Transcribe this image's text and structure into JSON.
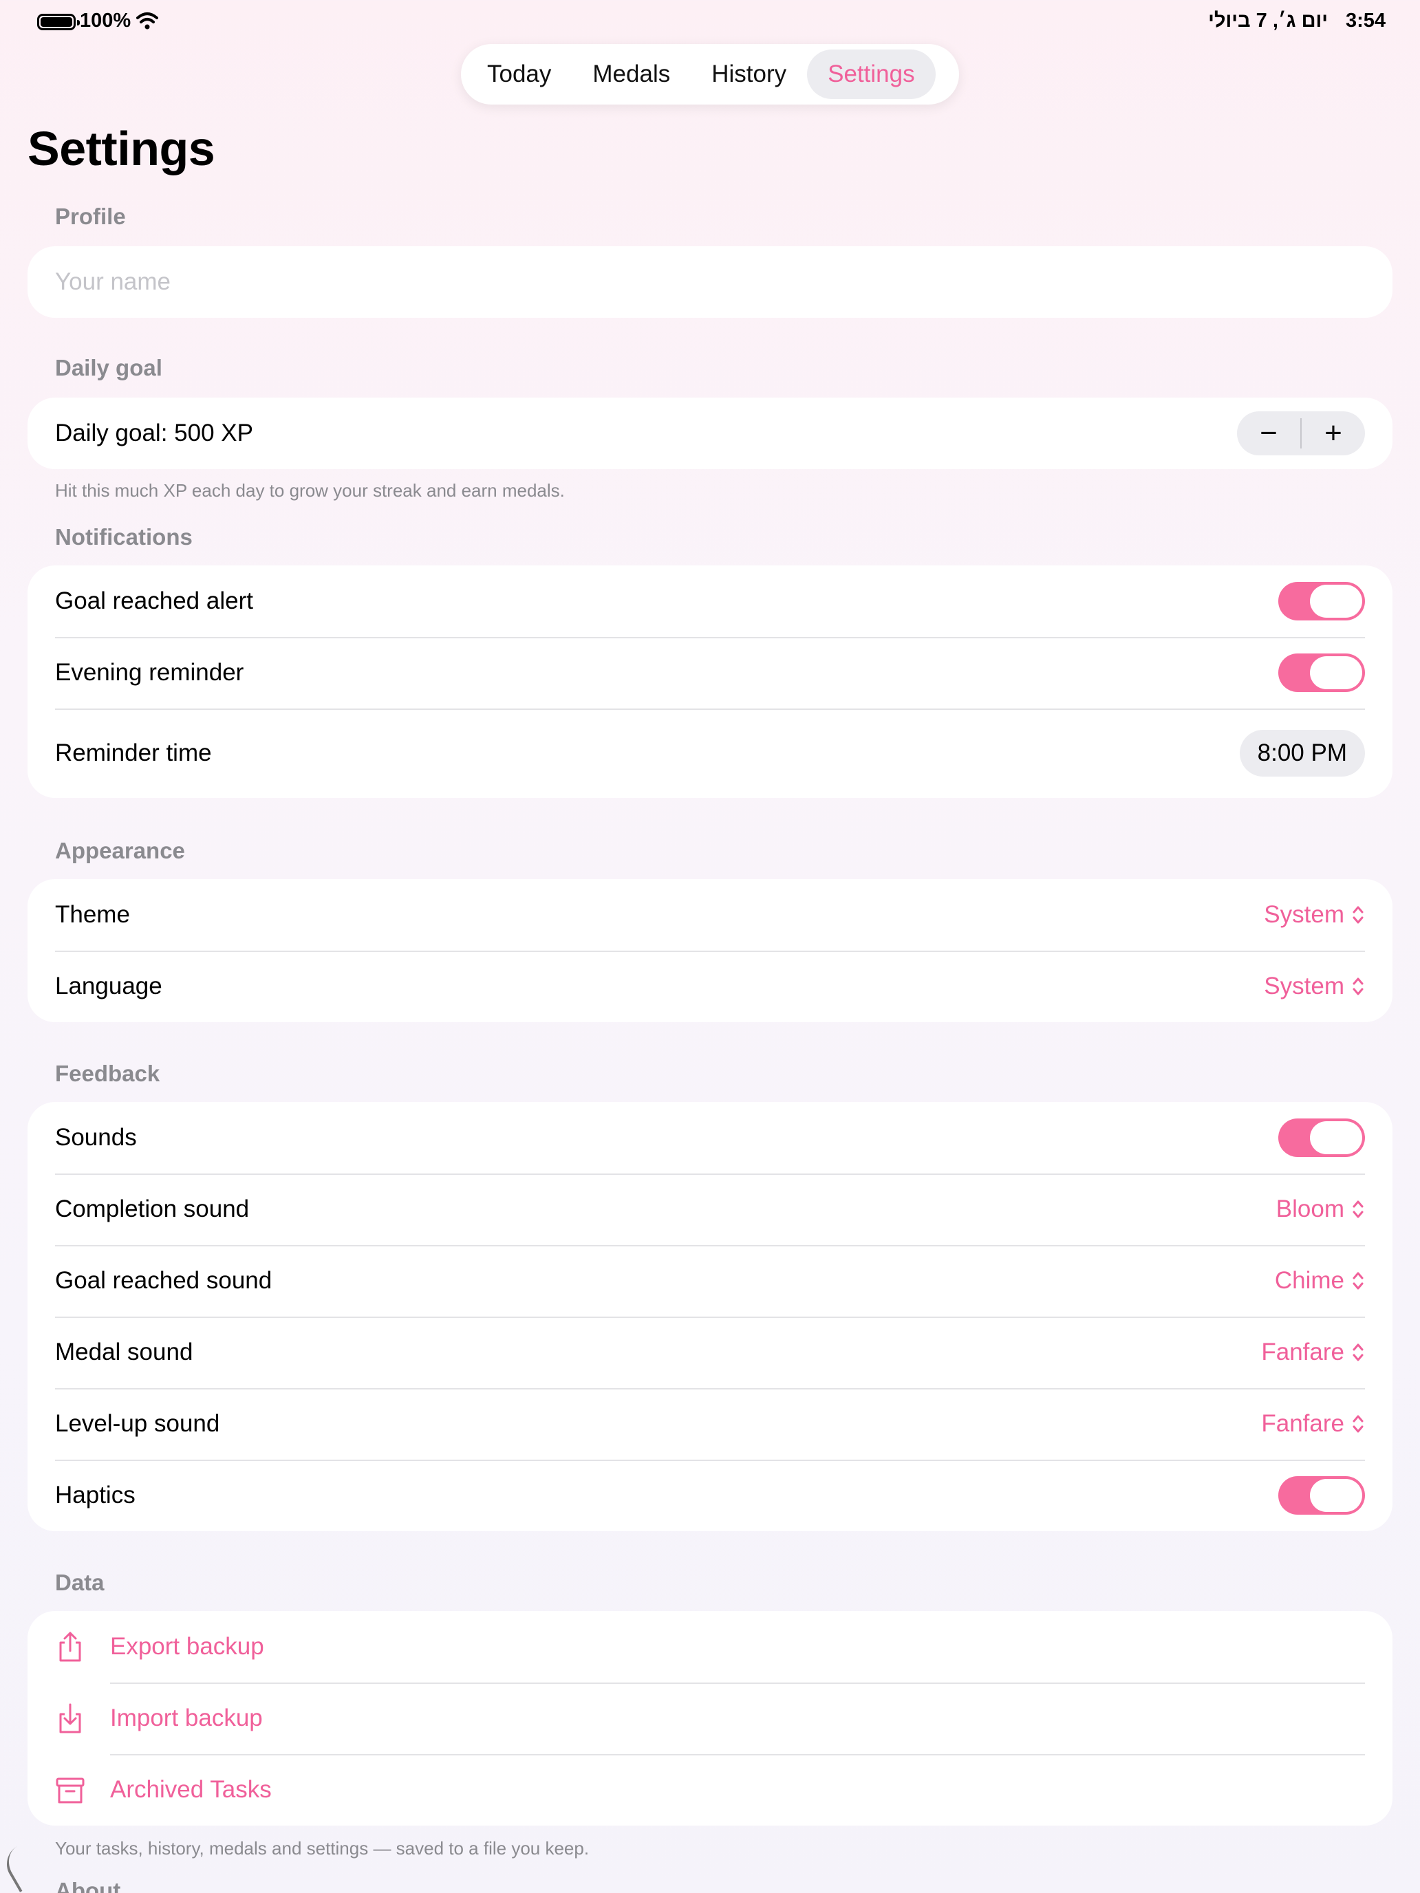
{
  "status_bar": {
    "battery": "100%",
    "date": "יום ג׳, 7 ביולי",
    "time": "3:54"
  },
  "tabs": [
    {
      "label": "Today",
      "active": false
    },
    {
      "label": "Medals",
      "active": false
    },
    {
      "label": "History",
      "active": false
    },
    {
      "label": "Settings",
      "active": true
    }
  ],
  "page_title": "Settings",
  "profile": {
    "header": "Profile",
    "name_placeholder": "Your name",
    "name_value": ""
  },
  "daily_goal": {
    "header": "Daily goal",
    "label": "Daily goal: 500 XP",
    "decrement": "−",
    "increment": "+",
    "footer": "Hit this much XP each day to grow your streak and earn medals."
  },
  "notifications": {
    "header": "Notifications",
    "goal_alert": {
      "label": "Goal reached alert",
      "on": true
    },
    "evening_reminder": {
      "label": "Evening reminder",
      "on": true
    },
    "reminder_time": {
      "label": "Reminder time",
      "value": "8:00 PM"
    }
  },
  "appearance": {
    "header": "Appearance",
    "theme": {
      "label": "Theme",
      "value": "System"
    },
    "language": {
      "label": "Language",
      "value": "System"
    }
  },
  "feedback": {
    "header": "Feedback",
    "sounds": {
      "label": "Sounds",
      "on": true
    },
    "completion_sound": {
      "label": "Completion sound",
      "value": "Bloom"
    },
    "goal_sound": {
      "label": "Goal reached sound",
      "value": "Chime"
    },
    "medal_sound": {
      "label": "Medal sound",
      "value": "Fanfare"
    },
    "levelup_sound": {
      "label": "Level-up sound",
      "value": "Fanfare"
    },
    "haptics": {
      "label": "Haptics",
      "on": true
    }
  },
  "data": {
    "header": "Data",
    "export": {
      "label": "Export backup",
      "icon": "share-icon"
    },
    "import": {
      "label": "Import backup",
      "icon": "import-icon"
    },
    "archived": {
      "label": "Archived Tasks",
      "icon": "archive-box-icon"
    },
    "footer": "Your tasks, history, medals and settings — saved to a file you keep."
  },
  "about": {
    "header": "About"
  },
  "colors": {
    "accent": "#f0609a",
    "toggle_on": "#f76b9e",
    "secondary_text": "#8a8a8f"
  }
}
